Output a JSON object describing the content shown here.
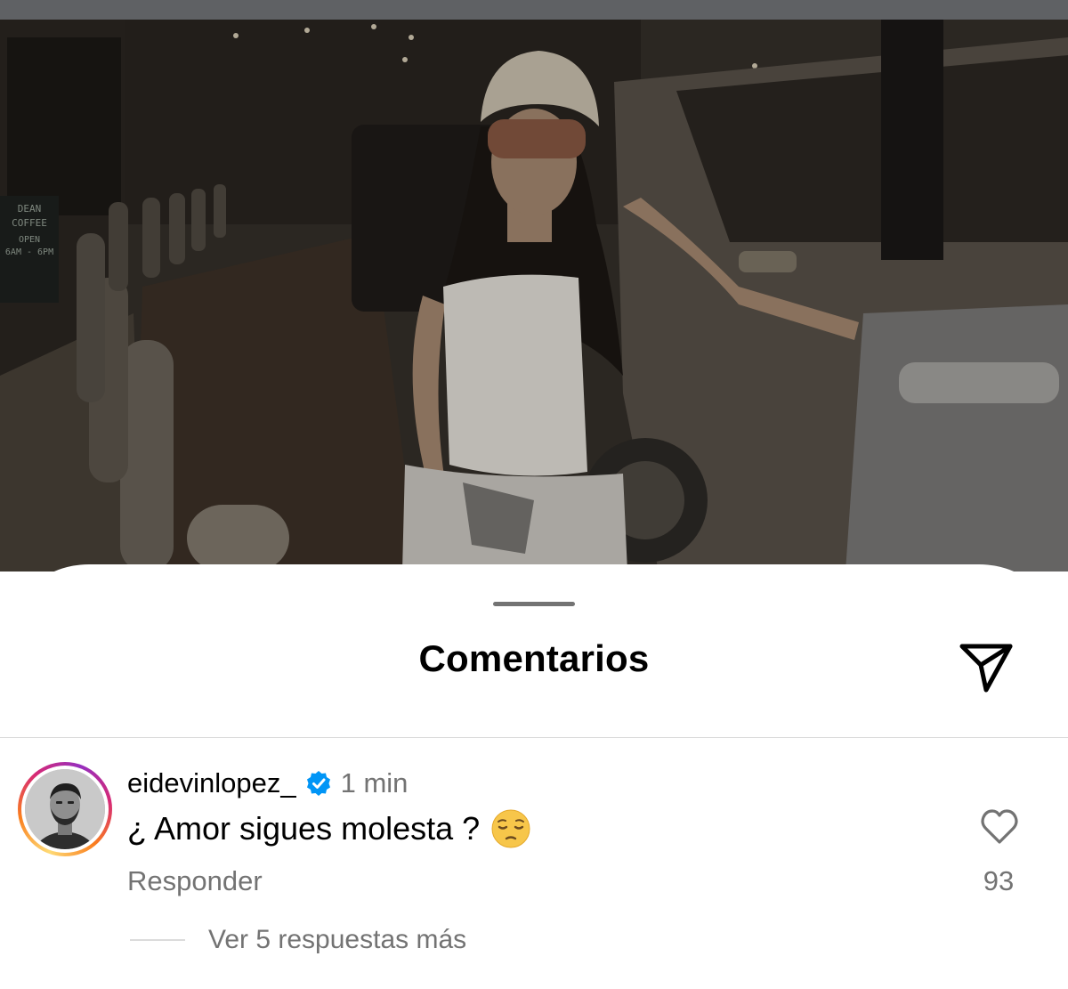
{
  "sheet": {
    "title": "Comentarios"
  },
  "icons": {
    "share": "paper-plane-icon",
    "verified": "verified-badge-icon",
    "like": "heart-outline-icon"
  },
  "colors": {
    "secondary_text": "#737373",
    "verified_blue": "#0095f6",
    "divider": "#dbdbdb"
  },
  "comment": {
    "username": "eidevinlopez_",
    "timestamp": "1 min",
    "text": "¿ Amor sigues molesta ?",
    "emoji": "pensive-face",
    "reply_label": "Responder",
    "like_count": "93",
    "view_replies_label": "Ver 5 respuestas más"
  },
  "photo": {
    "sign_lines": [
      "DEAN",
      "COFFEE",
      "OPEN",
      "6AM - 6PM"
    ]
  }
}
